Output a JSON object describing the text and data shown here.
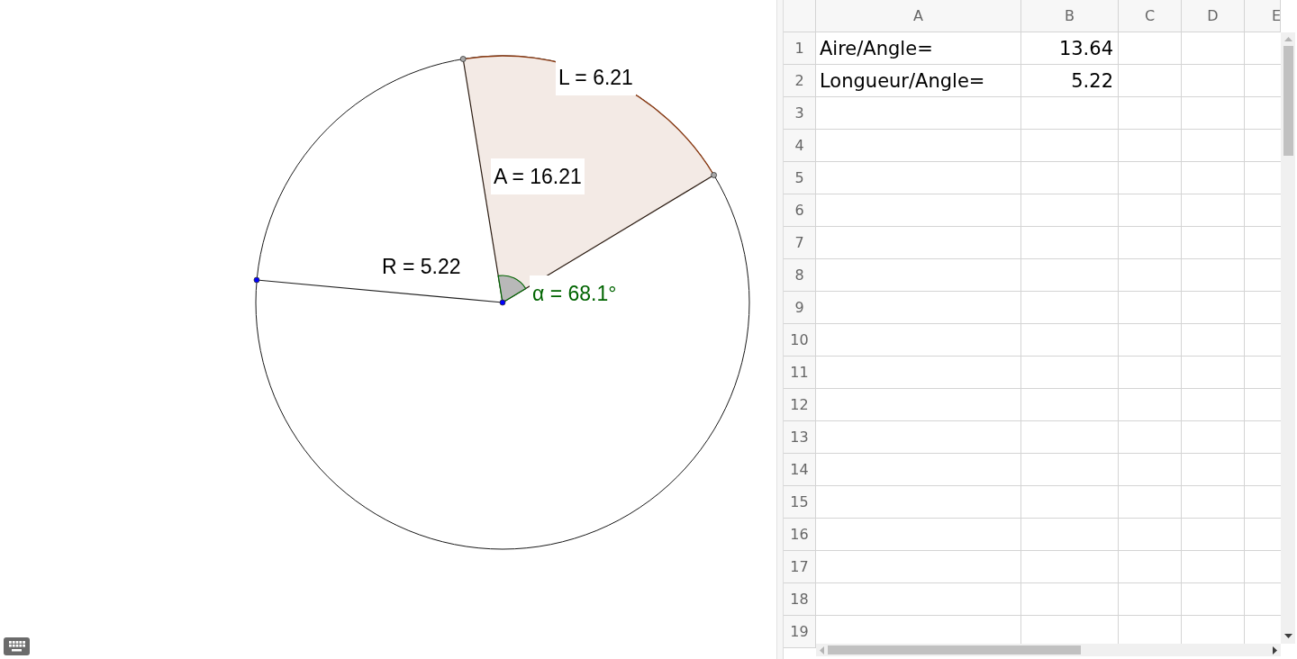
{
  "graphics": {
    "labels": [
      {
        "text": "L = 6.21",
        "color": "#000000"
      },
      {
        "text": "A = 16.21",
        "color": "#000000"
      },
      {
        "text": "R = 5.22",
        "color": "#000000"
      },
      {
        "text": "α = 68.1°",
        "color": "#006400"
      }
    ],
    "points": [
      {
        "color": "#0000ff"
      },
      {
        "color": "#0000ff"
      },
      {
        "color": "#a8a8a8"
      },
      {
        "color": "#a8a8a8"
      }
    ]
  },
  "spreadsheet": {
    "columns": [
      "A",
      "B",
      "C",
      "D",
      "E"
    ],
    "rows": [
      {
        "header": "1",
        "cells": [
          {
            "kind": "text",
            "value": "Aire/Angle="
          },
          {
            "kind": "number",
            "value": "13.64"
          }
        ]
      },
      {
        "header": "2",
        "cells": [
          {
            "kind": "text",
            "value": "Longueur/Angle="
          },
          {
            "kind": "number",
            "value": "5.22"
          }
        ]
      },
      {
        "header": "3"
      },
      {
        "header": "4"
      },
      {
        "header": "5"
      },
      {
        "header": "6"
      },
      {
        "header": "7"
      },
      {
        "header": "8"
      },
      {
        "header": "9"
      },
      {
        "header": "10"
      },
      {
        "header": "11"
      },
      {
        "header": "12"
      },
      {
        "header": "13"
      },
      {
        "header": "14"
      },
      {
        "header": "15"
      },
      {
        "header": "16"
      },
      {
        "header": "17"
      },
      {
        "header": "18"
      },
      {
        "header": "19"
      }
    ]
  }
}
